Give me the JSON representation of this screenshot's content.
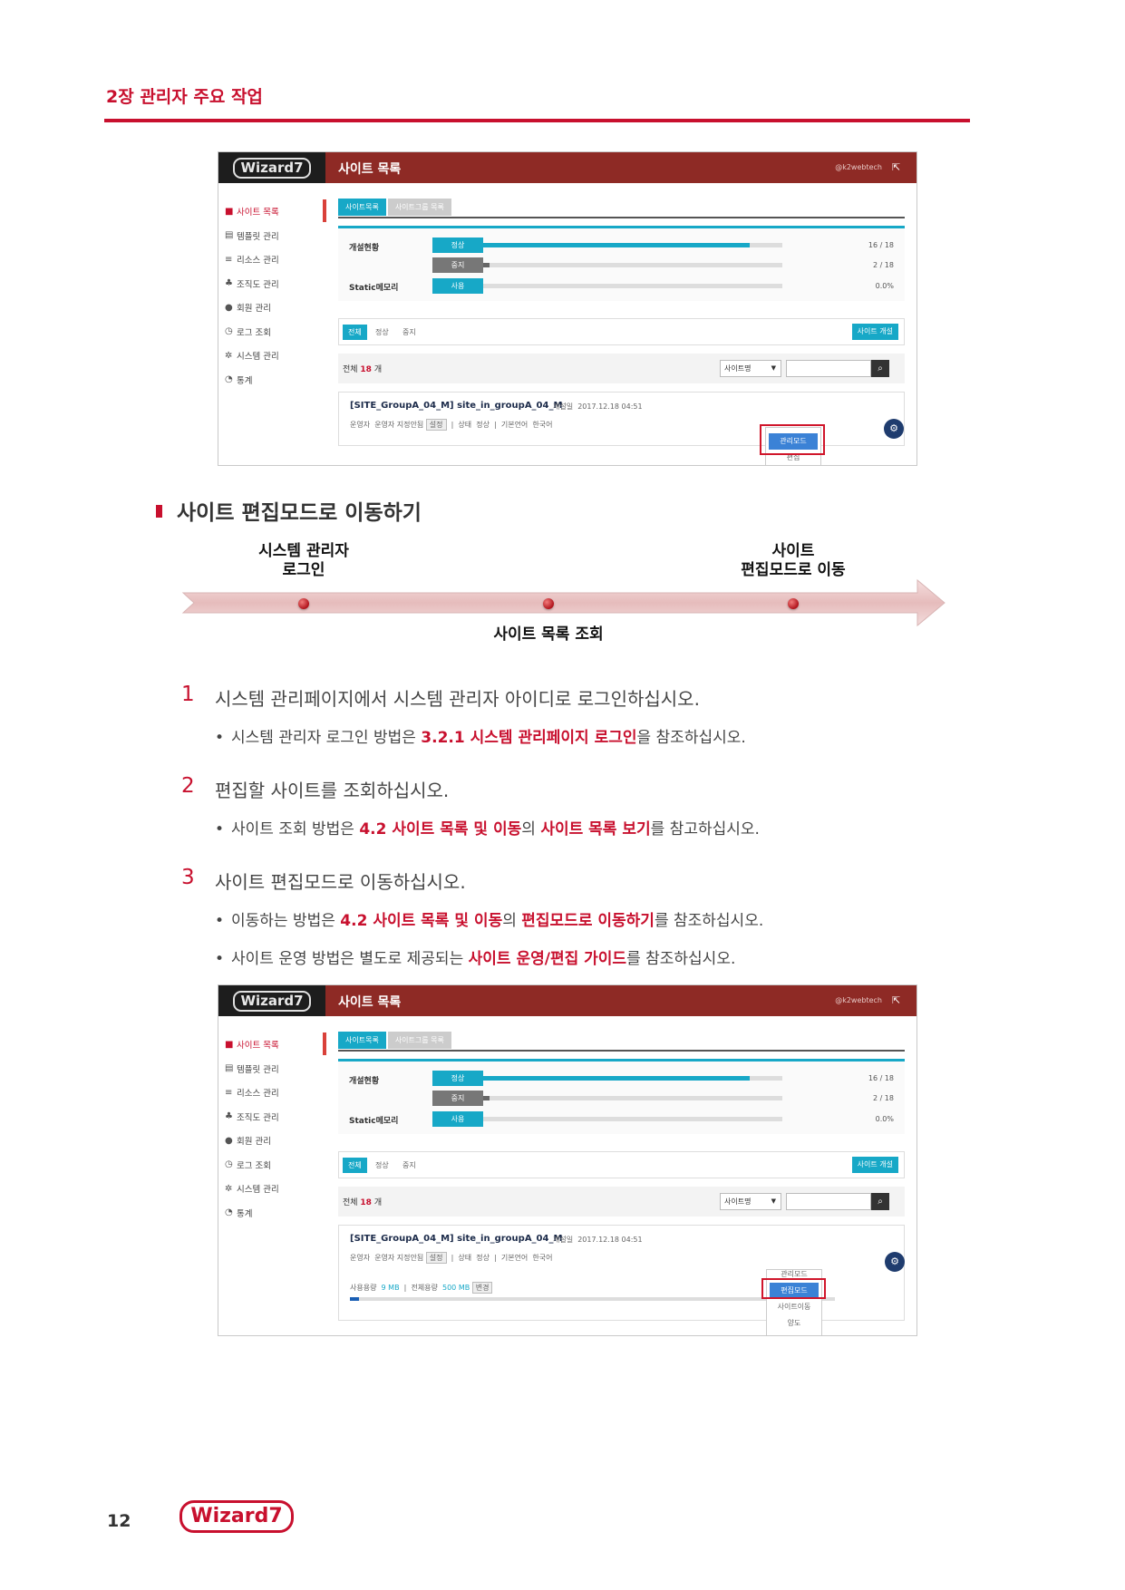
{
  "header": {
    "chapter": "2장 관리자 주요 작업"
  },
  "screenshot": {
    "logo": "Wizard7",
    "title": "사이트 목록",
    "user": "@k2webtech",
    "menu": [
      "사이트 목록",
      "템플릿 관리",
      "리소스 관리",
      "조직도 관리",
      "회원 관리",
      "로그 조회",
      "시스템 관리",
      "통계"
    ],
    "tabs": [
      "사이트목록",
      "사이트그룹 목록"
    ],
    "stats": {
      "label_open": "개설현황",
      "label_static": "Static메모리",
      "normal": "정상",
      "normal_value": "16 / 18",
      "stopped": "중지",
      "stopped_value": "2 / 18",
      "used": "사용",
      "used_value": "0.0%"
    },
    "filters": [
      "전체",
      "정상",
      "중지"
    ],
    "create_button": "사이트 개설",
    "count_prefix": "전체 ",
    "count_value": "18",
    "count_suffix": " 개",
    "select_value": "사이트명",
    "site": {
      "name": "[SITE_GroupA_04_M] site_in_groupA_04_M",
      "date_label": "개설일",
      "date": "2017.12.18 04:51",
      "operator_label": "운영자",
      "operator": "운영자 지정안됨",
      "set_chip": "설정",
      "status_label": "상태",
      "status": "정상",
      "lang_label": "기본언어",
      "lang": "한국어",
      "usage_label": "사용용량",
      "usage": "9 MB",
      "total_label": "전체용량",
      "total": "500 MB",
      "change_chip": "변경"
    },
    "dropdown1": [
      "관리모드",
      "편집"
    ],
    "dropdown2": [
      "관리모드",
      "편집모드",
      "사이트이동",
      "양도"
    ]
  },
  "section": {
    "title": "사이트 편집모드로 이동하기"
  },
  "flow": {
    "left_line1": "시스템 관리자",
    "left_line2": "로그인",
    "center": "사이트 목록 조회",
    "right_line1": "사이트",
    "right_line2": "편집모드로 이동"
  },
  "steps": [
    {
      "num": "1",
      "text": "시스템 관리페이지에서 시스템 관리자 아이디로 로그인하십시오.",
      "b1_a": "시스템 관리자 로그인 방법은 ",
      "b1_h1": "3.2.1 시스템 관리페이지 로그인",
      "b1_b": "을 참조하십시오."
    },
    {
      "num": "2",
      "text": "편집할 사이트를 조회하십시오.",
      "b1_a": "사이트 조회 방법은 ",
      "b1_h1": "4.2 사이트 목록 및 이동",
      "b1_b": "의 ",
      "b1_h2": "사이트 목록 보기",
      "b1_c": "를 참고하십시오."
    },
    {
      "num": "3",
      "text": "사이트 편집모드로 이동하십시오.",
      "b1_a": "이동하는 방법은 ",
      "b1_h1": "4.2 사이트 목록 및 이동",
      "b1_b": "의 ",
      "b1_h2": "편집모드로 이동하기",
      "b1_c": "를 참조하십시오.",
      "b2_a": "사이트 운영 방법은 별도로 제공되는 ",
      "b2_h1": "사이트 운영/편집 가이드",
      "b2_b": "를 참조하십시오."
    }
  ],
  "footer": {
    "page": "12",
    "logo": "Wizard7"
  },
  "colors": {
    "accent": "#c8102e",
    "header_bar": "#8e2a25",
    "teal": "#17a8c7"
  }
}
